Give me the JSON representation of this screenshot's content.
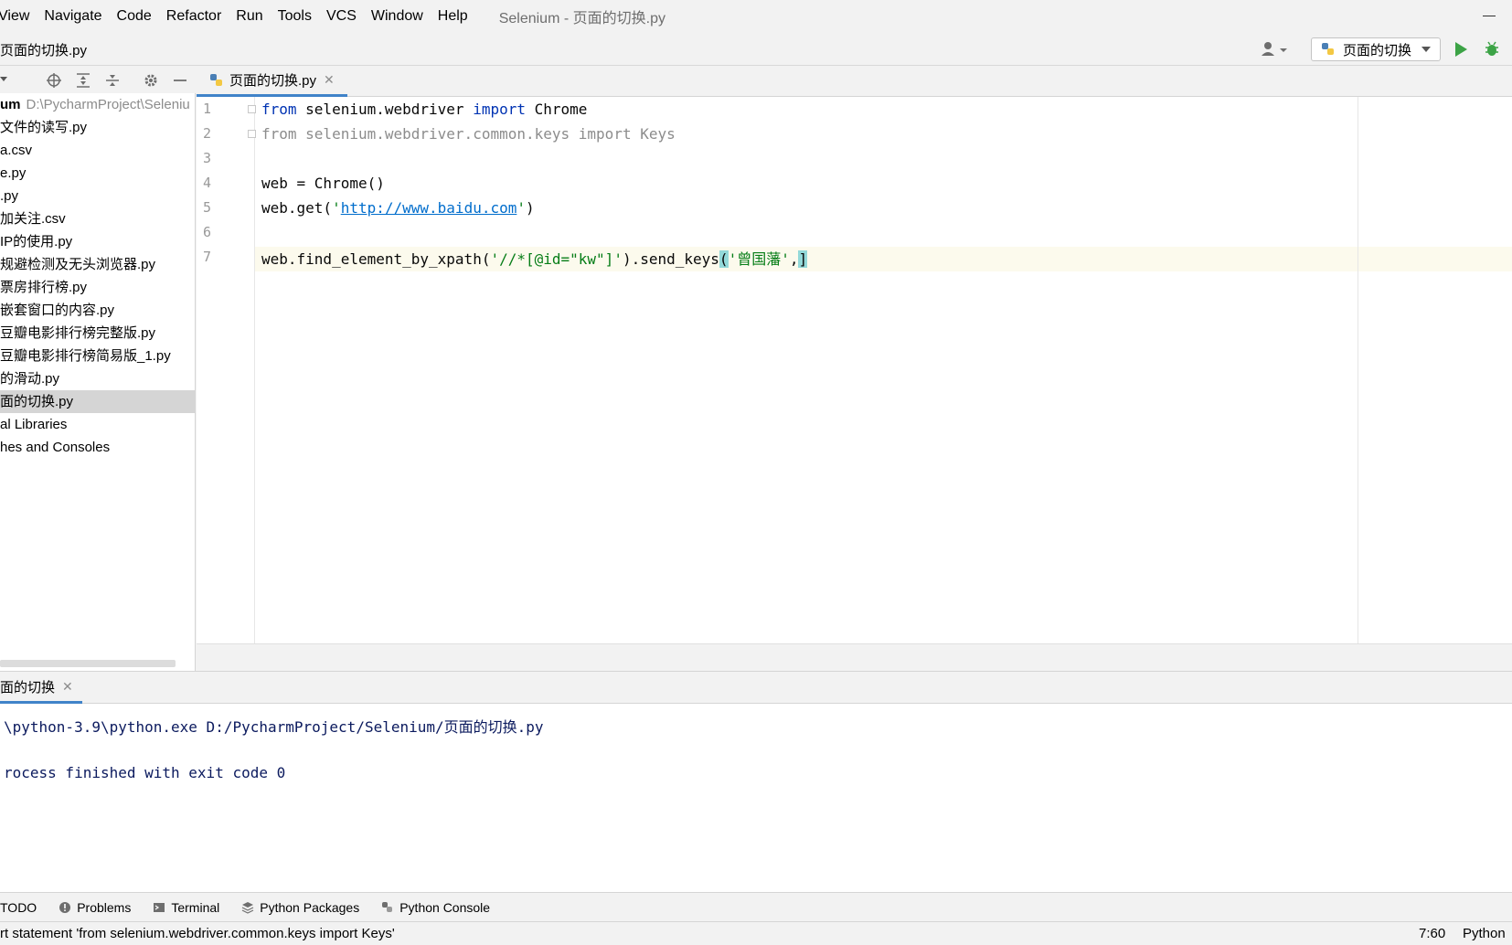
{
  "menubar": {
    "items": [
      "View",
      "Navigate",
      "Code",
      "Refactor",
      "Run",
      "Tools",
      "VCS",
      "Window",
      "Help"
    ],
    "window_title": "Selenium - 页面的切换.py"
  },
  "navbar": {
    "file": "页面的切换.py",
    "run_config": "页面的切换"
  },
  "project": {
    "root_name": "um",
    "root_path": "D:\\PycharmProject\\Seleniu",
    "files": [
      "文件的读写.py",
      "a.csv",
      "e.py",
      ".py",
      "加关注.csv",
      "IP的使用.py",
      "规避检测及无头浏览器.py",
      "票房排行榜.py",
      "嵌套窗口的内容.py",
      "豆瓣电影排行榜完整版.py",
      "豆瓣电影排行榜简易版_1.py",
      "的滑动.py",
      "面的切换.py"
    ],
    "extra": [
      "al Libraries",
      "hes and Consoles"
    ]
  },
  "editor": {
    "tab_label": "页面的切换.py",
    "line_numbers": [
      "1",
      "2",
      "3",
      "4",
      "5",
      "6",
      "7"
    ],
    "lines": {
      "l1_kw1": "from",
      "l1_mod": " selenium.webdriver ",
      "l1_kw2": "import",
      "l1_name": " Chrome",
      "l2": "from selenium.webdriver.common.keys import Keys",
      "l4": "web = Chrome()",
      "l5_pre": "web.get(",
      "l5_q1": "'",
      "l5_url": "http://www.baidu.com",
      "l5_q2": "'",
      "l5_post": ")",
      "l7_pre": "web.find_element_by_xpath(",
      "l7_xpath": "'//*[@id=\"kw\"]'",
      "l7_mid": ").send_keys",
      "l7_paren": "(",
      "l7_arg": "'曾国藩'",
      "l7_comma": ",",
      "l7_caret": "]"
    }
  },
  "run": {
    "tab_label": "面的切换",
    "output": [
      "\\python-3.9\\python.exe D:/PycharmProject/Selenium/页面的切换.py",
      "",
      "rocess finished with exit code 0"
    ]
  },
  "tool_windows": [
    "TODO",
    "Problems",
    "Terminal",
    "Python Packages",
    "Python Console"
  ],
  "status": {
    "message": "rt statement 'from selenium.webdriver.common.keys import Keys'",
    "caret_position": "7:60",
    "language": "Python"
  },
  "colors": {
    "accent": "#4083c9",
    "run_green": "#3ca346",
    "keyword": "#0033b3",
    "string": "#067d17"
  }
}
